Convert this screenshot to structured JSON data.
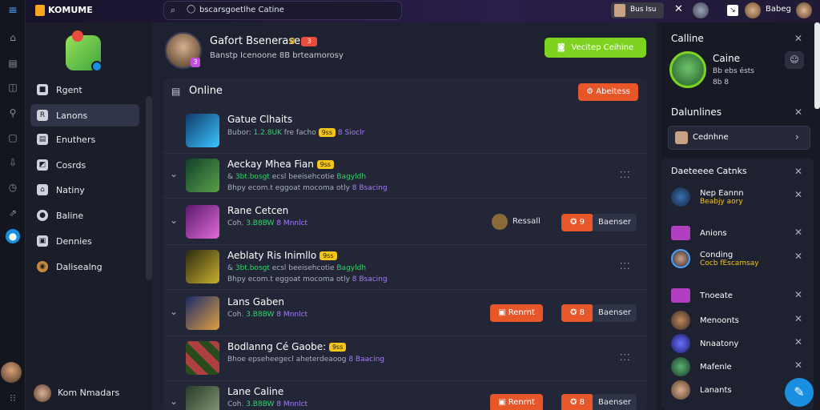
{
  "app": {
    "name": "KOMUME"
  },
  "topbar": {
    "search_text": "bscarsgoetlhe Catine",
    "user_chip": "Bus Isu",
    "user_name": "Babeg"
  },
  "sidebar": {
    "items": [
      {
        "label": "Rgent"
      },
      {
        "label": "Lanons"
      },
      {
        "label": "Enuthers"
      },
      {
        "label": "Cosrds"
      },
      {
        "label": "Natiny"
      },
      {
        "label": "Baline"
      },
      {
        "label": "Dennies"
      },
      {
        "label": "Dalisealng"
      }
    ],
    "footer_user": "Kom Nmadars"
  },
  "profile": {
    "name": "Gafort Bsenerase",
    "badge": "3",
    "subtitle": "Banstp Icenoone 8B brteamorosy",
    "avatar_badge": "3",
    "cta": "Vecitep Ceihine"
  },
  "online_panel": {
    "title": "Online",
    "action": "Abeitess",
    "rows": [
      {
        "title": "Gatue Clhaits",
        "tag": "",
        "line1a": "Bubor: ",
        "line1b": "1.2.8UK",
        "line1c": " fre facho ",
        "line1d": "8 Sioclr",
        "line2": "",
        "btn_a": "",
        "btn_b_count": "",
        "btn_b": "",
        "extra": ""
      },
      {
        "title": "Aeckay Mhea Fian",
        "tag": "9ss",
        "line1a": "& ",
        "line1b": "3bt.bosgt",
        "line1c": " ecsl beeisehcotie ",
        "line1d": "Bagyldh",
        "line2a": "Bhpy ecom.t eggoat mocoma otly ",
        "line2b": "8 Bsacing",
        "btn_a": "",
        "btn_b_count": "",
        "btn_b": "",
        "extra": "dots"
      },
      {
        "title": "Rane Cetcen",
        "tag": "",
        "line1a": "Coh. ",
        "line1b": "3.B8BW",
        "line1c": " ",
        "line1d": "8 Mnnlct",
        "line2": "",
        "btn_a": "",
        "btn_b_count": "9",
        "btn_b": "Baenser",
        "extra": "Ressall"
      },
      {
        "title": "Aeblaty Ris Inimllo",
        "tag": "9ss",
        "line1a": "& ",
        "line1b": "3bt.bosgt",
        "line1c": " ecsl beeisehcotie ",
        "line1d": "Bagyldh",
        "line2a": "Bhpy ecom.t eggoat mocoma otly ",
        "line2b": "8 Bsacing",
        "btn_a": "",
        "btn_b_count": "",
        "btn_b": "",
        "extra": "dots"
      },
      {
        "title": "Lans Gaben",
        "tag": "",
        "line1a": "Coh. ",
        "line1b": "3.B8BW",
        "line1c": " ",
        "line1d": "8 Mnnlct",
        "line2": "",
        "btn_a": "Renrnt",
        "btn_b_count": "8",
        "btn_b": "Baenser",
        "extra": ""
      },
      {
        "title": "Bodlanng Cé Gaobe:",
        "tag": "9ss",
        "line1a": "Bhoe ",
        "line1b": "",
        "line1c": "epseheegecl aheterdeaoog ",
        "line1d": "8 Baacing",
        "line2": "",
        "btn_a": "",
        "btn_b_count": "",
        "btn_b": "",
        "extra": "dots"
      },
      {
        "title": "Lane Caline",
        "tag": "",
        "line1a": "Coh. ",
        "line1b": "3.B8BW",
        "line1c": " ",
        "line1d": "8 Mnnlct",
        "line2": "",
        "btn_a": "Renrnt",
        "btn_b_count": "8",
        "btn_b": "Baenser",
        "extra": ""
      }
    ]
  },
  "right_panel": {
    "section1_title": "Calline",
    "user_name": "Caine",
    "user_sub": "Bb ebs ésts",
    "user_sub2": "8b 8",
    "section2_title": "Dalunlines",
    "select_value": "Cednhne",
    "section3_title": "Daeteeee Catnks",
    "people": [
      {
        "name": "Nep Eannn",
        "sub": "Beabjy aory"
      },
      {
        "name": "Anions",
        "sub": ""
      },
      {
        "name": "Conding",
        "sub": "Cocb fEscamsay"
      },
      {
        "name": "Tnoeate",
        "sub": ""
      },
      {
        "name": "Menoonts",
        "sub": ""
      },
      {
        "name": "Nnaatony",
        "sub": ""
      },
      {
        "name": "Mafenle",
        "sub": ""
      },
      {
        "name": "Lanants",
        "sub": ""
      }
    ]
  },
  "colors": {
    "accent_green": "#7ed321",
    "accent_orange": "#e8572a",
    "accent_purple": "#a67cff"
  }
}
